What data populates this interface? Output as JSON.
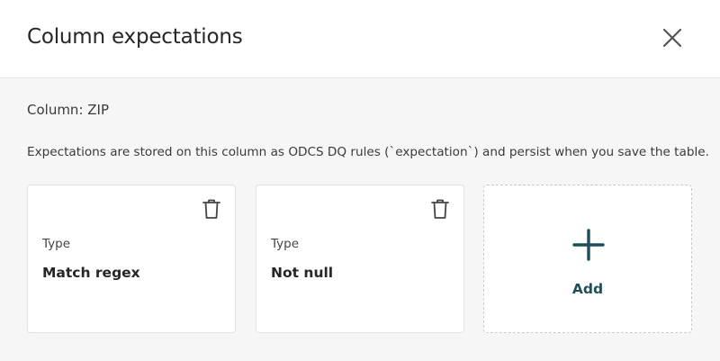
{
  "dialog": {
    "title": "Column expectations",
    "close_icon": "close-icon"
  },
  "column": {
    "label": "Column: ZIP"
  },
  "description": "Expectations are stored on this column as ODCS DQ rules (`expectation`) and persist when you save the table.",
  "expectations": [
    {
      "type_label": "Type",
      "type_value": "Match regex",
      "delete_icon": "trash-icon"
    },
    {
      "type_label": "Type",
      "type_value": "Not null",
      "delete_icon": "trash-icon"
    }
  ],
  "add_card": {
    "label": "Add",
    "icon": "plus-icon"
  },
  "colors": {
    "accent": "#1f4e5a",
    "background": "#f6f6f6",
    "card_border": "#e2e2e2"
  }
}
